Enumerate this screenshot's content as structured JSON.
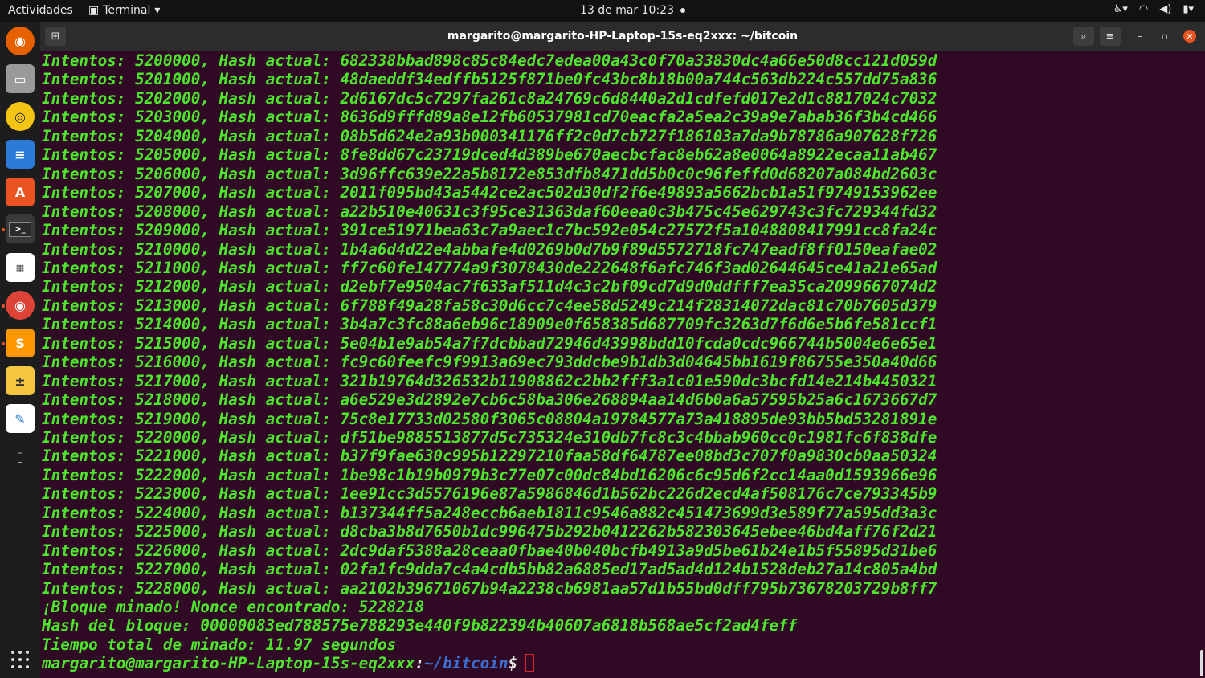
{
  "topbar": {
    "activities": "Actividades",
    "app_name": "Terminal",
    "clock": "13 de mar  10:23"
  },
  "window": {
    "title": "margarito@margarito-HP-Laptop-15s-eq2xxx: ~/bitcoin"
  },
  "terminal": {
    "hash_lines": [
      "Intentos: 5200000, Hash actual: 682338bbad898c85c84edc7edea00a43c0f70a33830dc4a66e50d8cc121d059d",
      "Intentos: 5201000, Hash actual: 48daeddf34edffb5125f871be0fc43bc8b18b00a744c563db224c557dd75a836",
      "Intentos: 5202000, Hash actual: 2d6167dc5c7297fa261c8a24769c6d8440a2d1cdfefd017e2d1c8817024c7032",
      "Intentos: 5203000, Hash actual: 8636d9fffd89a8e12fb60537981cd70eacfa2a5ea2c39a9e7abab36f3b4cd466",
      "Intentos: 5204000, Hash actual: 08b5d624e2a93b000341176ff2c0d7cb727f186103a7da9b78786a907628f726",
      "Intentos: 5205000, Hash actual: 8fe8dd67c23719dced4d389be670aecbcfac8eb62a8e0064a8922ecaa11ab467",
      "Intentos: 5206000, Hash actual: 3d96ffc639e22a5b8172e853dfb8471dd5b0c0c96feffd0d68207a084bd2603c",
      "Intentos: 5207000, Hash actual: 2011f095bd43a5442ce2ac502d30df2f6e49893a5662bcb1a51f9749153962ee",
      "Intentos: 5208000, Hash actual: a22b510e40631c3f95ce31363daf60eea0c3b475c45e629743c3fc729344fd32",
      "Intentos: 5209000, Hash actual: 391ce51971bea63c7a9aec1c7bc592e054c27572f5a1048808417991cc8fa24c",
      "Intentos: 5210000, Hash actual: 1b4a6d4d22e4abbafe4d0269b0d7b9f89d5572718fc747eadf8ff0150eafae02",
      "Intentos: 5211000, Hash actual: ff7c60fe147774a9f3078430de222648f6afc746f3ad02644645ce41a21e65ad",
      "Intentos: 5212000, Hash actual: d2ebf7e9504ac7f633af511d4c3c2bf09cd7d9d0ddfff7ea35ca2099667074d2",
      "Intentos: 5213000, Hash actual: 6f788f49a28fa58c30d6cc7c4ee58d5249c214f28314072dac81c70b7605d379",
      "Intentos: 5214000, Hash actual: 3b4a7c3fc88a6eb96c18909e0f658385d687709fc3263d7f6d6e5b6fe581ccf1",
      "Intentos: 5215000, Hash actual: 5e04b1e9ab54a7f7dcbbad72946d43998bdd10fcda0cdc966744b5004e6e65e1",
      "Intentos: 5216000, Hash actual: fc9c60feefc9f9913a69ec793ddcbe9b1db3d04645bb1619f86755e350a40d66",
      "Intentos: 5217000, Hash actual: 321b19764d326532b11908862c2bb2fff3a1c01e590dc3bcfd14e214b4450321",
      "Intentos: 5218000, Hash actual: a6e529e3d2892e7cb6c58ba306e268894aa14d6b0a6a57595b25a6c1673667d7",
      "Intentos: 5219000, Hash actual: 75c8e17733d02580f3065c08804a19784577a73a418895de93bb5bd53281891e",
      "Intentos: 5220000, Hash actual: df51be9885513877d5c735324e310db7fc8c3c4bbab960cc0c1981fc6f838dfe",
      "Intentos: 5221000, Hash actual: b37f9fae630c995b12297210faa58df64787ee08bd3c707f0a9830cb0aa50324",
      "Intentos: 5222000, Hash actual: 1be98c1b19b0979b3c77e07c00dc84bd16206c6c95d6f2cc14aa0d1593966e96",
      "Intentos: 5223000, Hash actual: 1ee91cc3d5576196e87a5986846d1b562bc226d2ecd4af508176c7ce793345b9",
      "Intentos: 5224000, Hash actual: b137344ff5a248eccb6aeb1811c9546a882c451473699d3e589f77a595dd3a3c",
      "Intentos: 5225000, Hash actual: d8cba3b8d7650b1dc996475b292b0412262b582303645ebee46bd4aff76f2d21",
      "Intentos: 5226000, Hash actual: 2dc9daf5388a28ceaa0fbae40b040bcfb4913a9d5be61b24e1b5f55895d31be6",
      "Intentos: 5227000, Hash actual: 02fa1fc9dda7c4a4cdb5bb82a6885ed17ad5ad4d124b1528deb27a14c805a4bd",
      "Intentos: 5228000, Hash actual: aa2102b39671067b94a2238cb6981aa57d1b55bd0dff795b73678203729b8ff7"
    ],
    "found_line": "¡Bloque minado! Nonce encontrado: 5228218",
    "block_hash_line": "Hash del bloque: 00000083ed788575e788293e440f9b822394b40607a6818b568ae5cf2ad4feff",
    "time_line": "Tiempo total de minado: 11.97 segundos",
    "prompt": {
      "user_host": "margarito@margarito-HP-Laptop-15s-eq2xxx",
      "colon": ":",
      "path": "~/bitcoin",
      "dollar": "$"
    }
  },
  "dock": {
    "icons": [
      "firefox-icon",
      "files-icon",
      "rhythmbox-icon",
      "writer-icon",
      "software-icon",
      "terminal-icon",
      "sudoku-icon",
      "chrome-icon",
      "sublime-icon",
      "calculator-icon",
      "text-editor-icon",
      "usb-icon"
    ]
  },
  "colors": {
    "terminal_bg": "#300a24",
    "text_green": "#4ee62d",
    "path_blue": "#3b6fd1",
    "accent_orange": "#e95420"
  }
}
